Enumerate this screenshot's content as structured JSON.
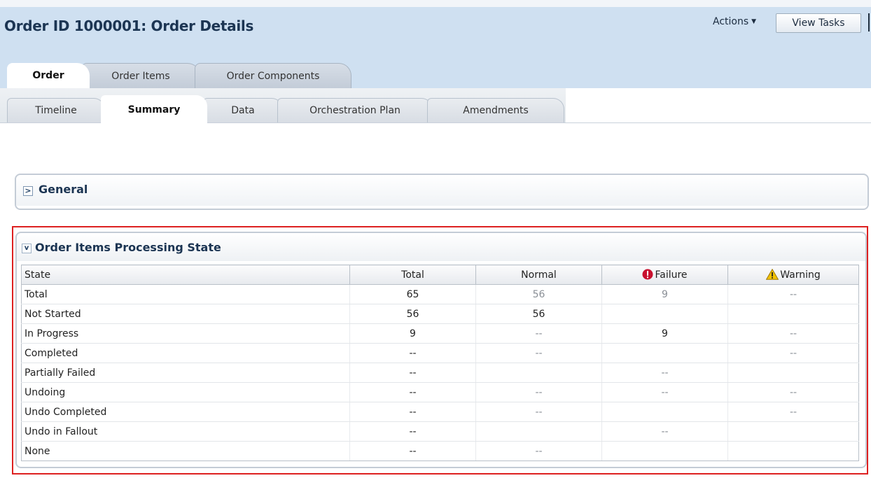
{
  "header": {
    "title": "Order ID 1000001: Order Details",
    "actions_label": "Actions",
    "view_tasks_label": "View Tasks"
  },
  "tabs_primary": [
    {
      "label": "Order",
      "active": true
    },
    {
      "label": "Order Items",
      "active": false
    },
    {
      "label": "Order Components",
      "active": false
    }
  ],
  "tabs_secondary": [
    {
      "label": "Timeline",
      "active": false
    },
    {
      "label": "Summary",
      "active": true
    },
    {
      "label": "Data",
      "active": false
    },
    {
      "label": "Orchestration Plan",
      "active": false
    },
    {
      "label": "Amendments",
      "active": false
    }
  ],
  "general": {
    "title": "General",
    "expanded": false,
    "disclosure": ">"
  },
  "processing": {
    "title": "Order Items Processing State",
    "expanded": true,
    "disclosure": "v",
    "columns": [
      "State",
      "Total",
      "Normal",
      "Failure",
      "Warning"
    ],
    "column_icons": {
      "Failure": "error-icon",
      "Warning": "warning-icon"
    },
    "rows": [
      {
        "state": "Total",
        "total": "65",
        "normal": "56",
        "failure": "9",
        "warning": "--"
      },
      {
        "state": "Not Started",
        "total": "56",
        "normal": "56",
        "failure": "",
        "warning": ""
      },
      {
        "state": "In Progress",
        "total": "9",
        "normal": "--",
        "failure": "9",
        "warning": "--"
      },
      {
        "state": "Completed",
        "total": "--",
        "normal": "--",
        "failure": "",
        "warning": "--"
      },
      {
        "state": "Partially Failed",
        "total": "--",
        "normal": "",
        "failure": "--",
        "warning": ""
      },
      {
        "state": "Undoing",
        "total": "--",
        "normal": "--",
        "failure": "--",
        "warning": "--"
      },
      {
        "state": "Undo Completed",
        "total": "--",
        "normal": "--",
        "failure": "",
        "warning": "--"
      },
      {
        "state": "Undo in Fallout",
        "total": "--",
        "normal": "",
        "failure": "--",
        "warning": ""
      },
      {
        "state": "None",
        "total": "--",
        "normal": "--",
        "failure": "",
        "warning": ""
      }
    ]
  },
  "colors": {
    "header_bg": "#cfe0f1",
    "title_text": "#1c3553",
    "highlight_border": "#dd2020",
    "error_red": "#c8102e",
    "warning_yellow": "#f2c200"
  }
}
